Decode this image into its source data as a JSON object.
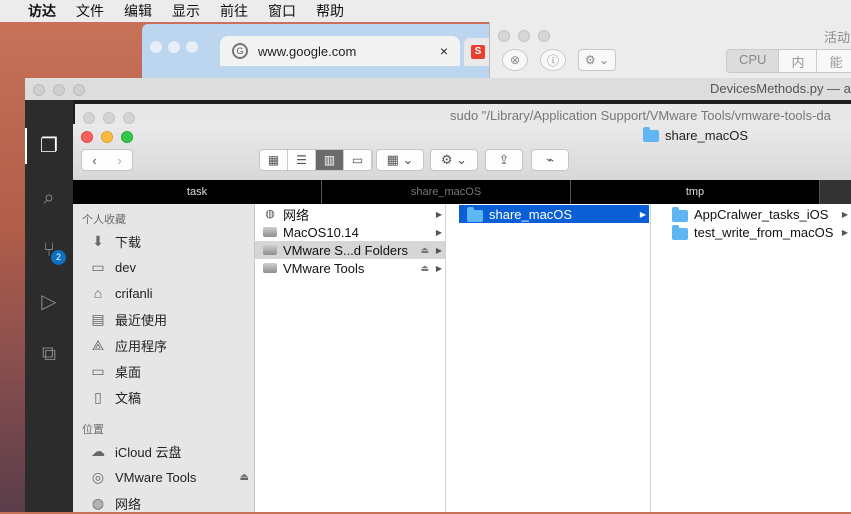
{
  "menubar": {
    "apple": "",
    "items": [
      "访达",
      "文件",
      "编辑",
      "显示",
      "前往",
      "窗口",
      "帮助"
    ]
  },
  "chrome": {
    "tab_title": "www.google.com",
    "tab_close": "×",
    "favicon": "G"
  },
  "activity_monitor": {
    "title": "活动监",
    "tabs": [
      "CPU",
      "内存",
      "能"
    ]
  },
  "vscode": {
    "title": "DevicesMethods.py — ap",
    "scm_badge": "2"
  },
  "terminal": {
    "title": "sudo \"/Library/Application Support/VMware Tools/vmware-tools-da"
  },
  "finder": {
    "title": "share_macOS",
    "path_tabs": [
      "task",
      "share_macOS",
      "tmp"
    ],
    "sidebar": {
      "favorites_header": "个人收藏",
      "favorites": [
        {
          "icon": "download-icon",
          "label": "下载"
        },
        {
          "icon": "folder-icon",
          "label": "dev"
        },
        {
          "icon": "home-icon",
          "label": "crifanli"
        },
        {
          "icon": "recents-icon",
          "label": "最近使用"
        },
        {
          "icon": "applications-icon",
          "label": "应用程序"
        },
        {
          "icon": "desktop-icon",
          "label": "桌面"
        },
        {
          "icon": "documents-icon",
          "label": "文稿"
        }
      ],
      "locations_header": "位置",
      "locations": [
        {
          "icon": "icloud-icon",
          "label": "iCloud 云盘"
        },
        {
          "icon": "disc-icon",
          "label": "VMware Tools"
        },
        {
          "icon": "network-icon",
          "label": "网络"
        }
      ]
    },
    "column1": [
      {
        "icon": "network-icon",
        "label": "网络"
      },
      {
        "icon": "disk-icon",
        "label": "MacOS10.14"
      },
      {
        "icon": "vmware-shared-icon",
        "label": "VMware S...d Folders"
      },
      {
        "icon": "vmware-tools-icon",
        "label": "VMware Tools"
      }
    ],
    "column2": [
      {
        "label": "share_macOS"
      }
    ],
    "column3": [
      {
        "label": "AppCralwer_tasks_iOS"
      },
      {
        "label": "test_write_from_macOS"
      }
    ]
  }
}
